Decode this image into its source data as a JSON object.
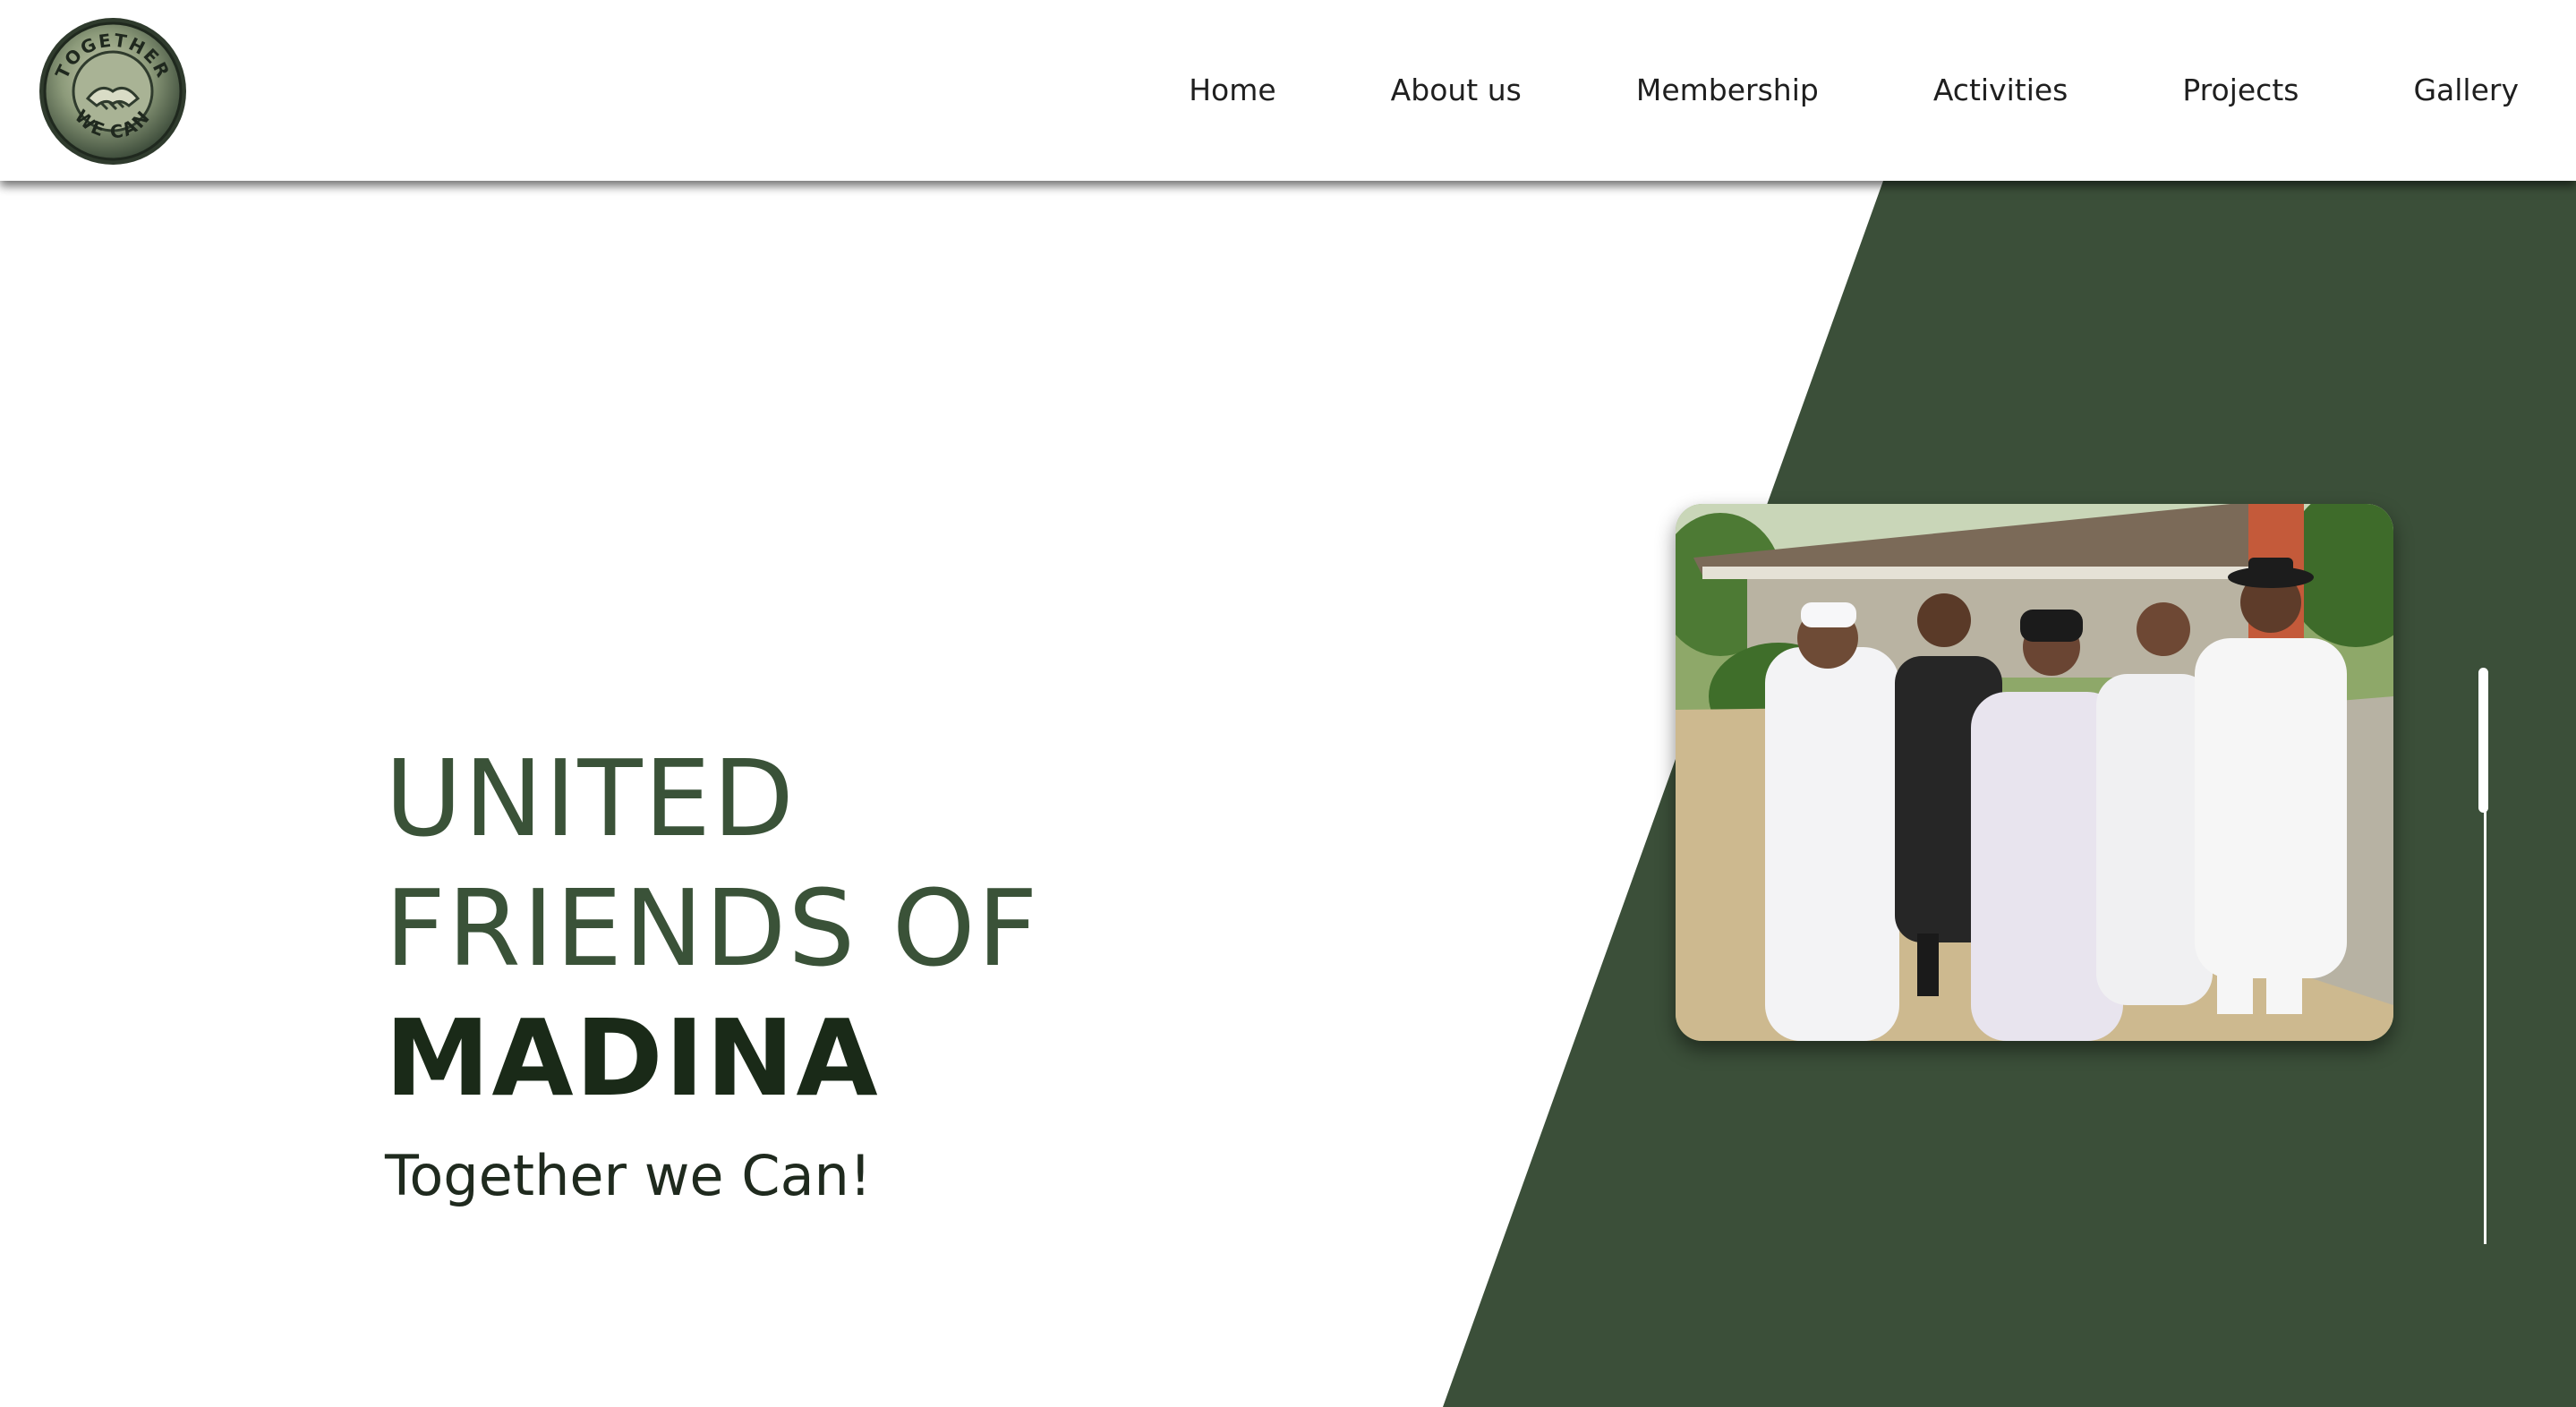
{
  "header": {
    "logo": {
      "top_text": "TOGETHER",
      "bottom_text": "WE CAN",
      "icon": "handshake-icon"
    },
    "nav": [
      {
        "label": "Home"
      },
      {
        "label": "About us"
      },
      {
        "label": "Membership"
      },
      {
        "label": "Activities"
      },
      {
        "label": "Projects"
      },
      {
        "label": "Gallery"
      }
    ]
  },
  "hero": {
    "title_line1": "UNITED",
    "title_line2": "FRIENDS OF",
    "title_line3": "MADINA",
    "tagline": "Together we Can!"
  },
  "photo": {
    "subject": "group-photo"
  },
  "colors": {
    "accent_green": "#3b4f39",
    "title_green": "#3a5238",
    "title_dark": "#1a2a18",
    "background": "#ffffff"
  }
}
